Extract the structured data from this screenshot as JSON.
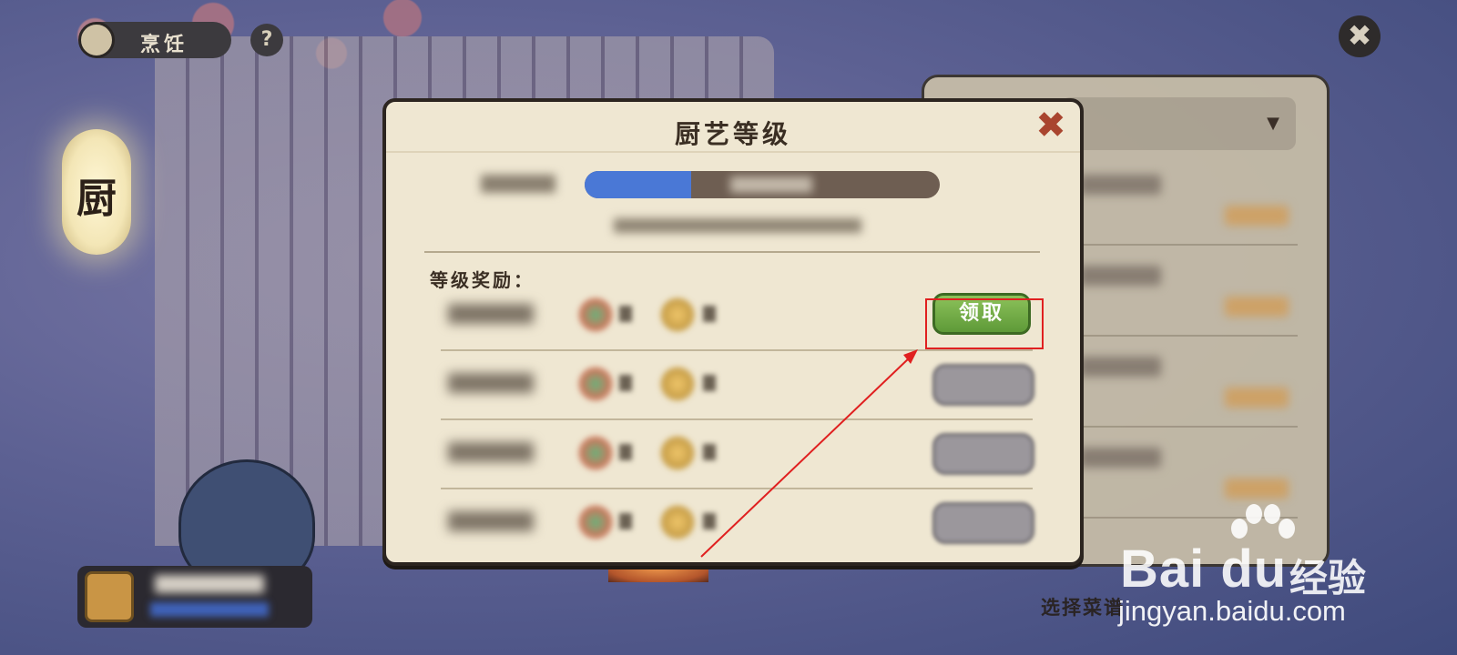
{
  "top_bar": {
    "cook_tab_label": "烹饪",
    "help_label": "?",
    "close_label": "✖"
  },
  "lantern": {
    "char": "厨"
  },
  "dialog": {
    "title": "厨艺等级",
    "close_label": "✖",
    "xp_progress": 0.3,
    "rewards_label": "等级奖励：",
    "rows": [
      {
        "claim_label": "领取",
        "claimable": true
      },
      {
        "claim_label": "",
        "claimable": false
      },
      {
        "claim_label": "",
        "claimable": false
      },
      {
        "claim_label": "",
        "claimable": false
      }
    ]
  },
  "side_panel": {
    "dropdown_arrow": "▼"
  },
  "footer": {
    "hint": "选择菜谱"
  },
  "watermark": {
    "brand": "Bai du",
    "cn": "经验",
    "url": "jingyan.baidu.com"
  },
  "colors": {
    "claim_green": "#6fae45",
    "highlight_red": "#e02020",
    "xp_blue": "#4a78d6",
    "dialog_bg": "#efe7d2"
  }
}
